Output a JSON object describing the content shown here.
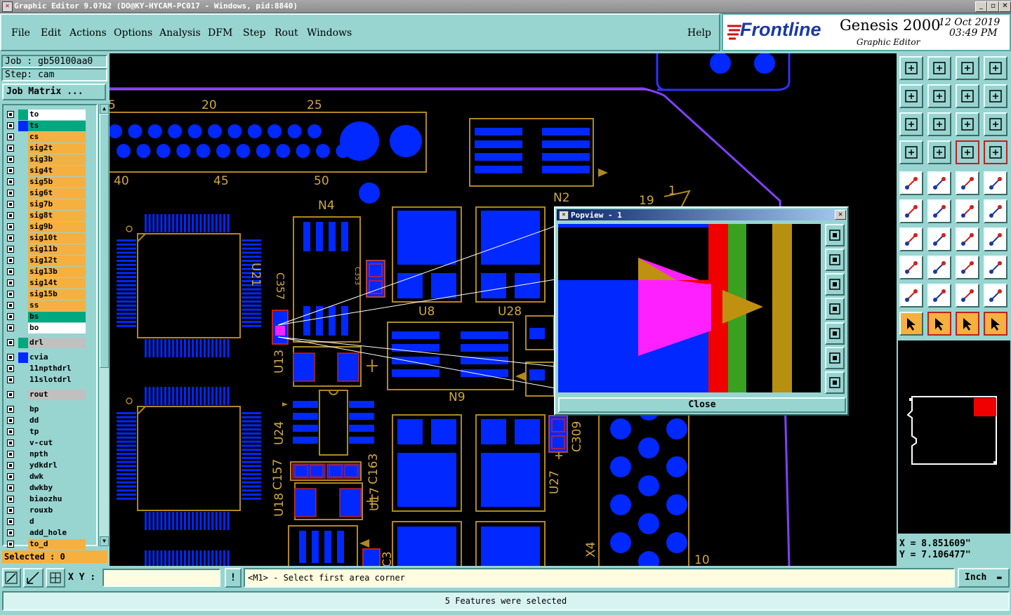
{
  "window": {
    "title": "Graphic Editor 9.0?b2 (DO@KY-HYCAM-PC017 - Windows, pid:8840)"
  },
  "menu": [
    "File",
    "Edit",
    "Actions",
    "Options",
    "Analysis",
    "DFM",
    "Step",
    "Rout",
    "Windows"
  ],
  "help_label": "Help",
  "brand": {
    "logo": "Frontline",
    "product": "Genesis 2000",
    "sub": "Graphic Editor",
    "date": "12 Oct 2019",
    "time": "03:49 PM"
  },
  "job": {
    "job_line": "Job : gb50100aa0",
    "step_line": "Step: cam",
    "matrix_button": "Job Matrix ..."
  },
  "layers": [
    {
      "name": "to",
      "color": "#ffffff"
    },
    {
      "name": "ts",
      "color": "#00a880"
    },
    {
      "name": "cs",
      "color": "#f5b040"
    },
    {
      "name": "sig2t",
      "color": "#f5b040"
    },
    {
      "name": "sig3b",
      "color": "#f5b040"
    },
    {
      "name": "sig4t",
      "color": "#f5b040"
    },
    {
      "name": "sig5b",
      "color": "#f5b040"
    },
    {
      "name": "sig6t",
      "color": "#f5b040"
    },
    {
      "name": "sig7b",
      "color": "#f5b040"
    },
    {
      "name": "sig8t",
      "color": "#f5b040"
    },
    {
      "name": "sig9b",
      "color": "#f5b040"
    },
    {
      "name": "sig10t",
      "color": "#f5b040"
    },
    {
      "name": "sig11b",
      "color": "#f5b040"
    },
    {
      "name": "sig12t",
      "color": "#f5b040"
    },
    {
      "name": "sig13b",
      "color": "#f5b040"
    },
    {
      "name": "sig14t",
      "color": "#f5b040"
    },
    {
      "name": "sig15b",
      "color": "#f5b040"
    },
    {
      "name": "ss",
      "color": "#f5b040"
    },
    {
      "name": "bs",
      "color": "#00a880"
    },
    {
      "name": "bo",
      "color": "#ffffff"
    }
  ],
  "layers2": [
    {
      "name": "drl",
      "color": "#c0c0c0"
    },
    {
      "name": "cvia",
      "color": "#98d4d0"
    },
    {
      "name": "11npthdrl",
      "color": "#98d4d0"
    },
    {
      "name": "11slotdrl",
      "color": "#98d4d0"
    },
    {
      "name": "rout",
      "color": "#c0c0c0"
    },
    {
      "name": "bp",
      "color": "#98d4d0"
    },
    {
      "name": "dd",
      "color": "#98d4d0"
    },
    {
      "name": "tp",
      "color": "#98d4d0"
    },
    {
      "name": "v-cut",
      "color": "#98d4d0"
    },
    {
      "name": "npth",
      "color": "#98d4d0"
    },
    {
      "name": "ydkdrl",
      "color": "#98d4d0"
    },
    {
      "name": "dwk",
      "color": "#98d4d0"
    },
    {
      "name": "dwkby",
      "color": "#98d4d0"
    },
    {
      "name": "biaozhu",
      "color": "#98d4d0"
    },
    {
      "name": "rouxb",
      "color": "#98d4d0"
    },
    {
      "name": "d",
      "color": "#98d4d0"
    },
    {
      "name": "add_hole",
      "color": "#98d4d0"
    },
    {
      "name": "to_d",
      "color": "#f5b040"
    }
  ],
  "selected": "Selected : 0",
  "canvas_labels": {
    "n20": "20",
    "n25": "25",
    "n5": "5",
    "n40": "40",
    "n45": "45",
    "n50": "50",
    "N4": "N4",
    "N2": "N2",
    "U21": "U21",
    "C357": "C357",
    "U8": "U8",
    "U28": "U28",
    "U13": "U13",
    "N9": "N9",
    "U24": "U24",
    "C157": "C157",
    "C163": "C163",
    "U18": "U18",
    "U17": "U17",
    "U27": "U27",
    "C309": "C309",
    "X4": "X4",
    "n10": "10",
    "n19": "19",
    "n1": "1",
    "C353": "C353",
    "C3": "C3"
  },
  "popview": {
    "title": "Popview - 1",
    "close": "Close"
  },
  "coords": {
    "x": "X = 8.851609\"",
    "y": "Y = 7.106477\""
  },
  "xy_label": "X Y :",
  "xy_value": "",
  "prompt": "<M1> - Select first area corner",
  "units": "Inch",
  "status": "5 Features were selected"
}
